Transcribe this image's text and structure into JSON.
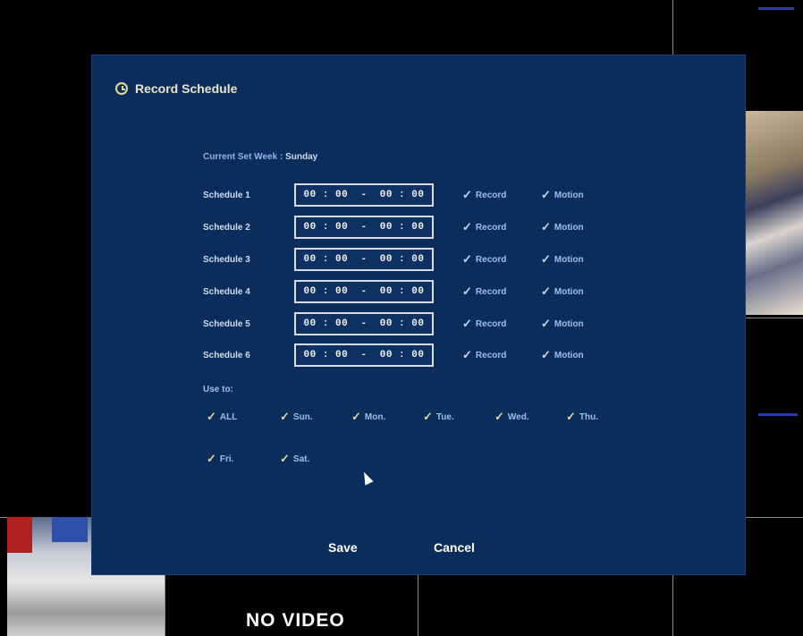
{
  "dialog": {
    "title": "Record Schedule",
    "current_week_label": "Current Set Week :",
    "current_week_value": "Sunday",
    "schedules": [
      {
        "label": "Schedule 1",
        "time": "00 : 00  -  00 : 00",
        "record": "Record",
        "motion": "Motion"
      },
      {
        "label": "Schedule 2",
        "time": "00 : 00  -  00 : 00",
        "record": "Record",
        "motion": "Motion"
      },
      {
        "label": "Schedule 3",
        "time": "00 : 00  -  00 : 00",
        "record": "Record",
        "motion": "Motion"
      },
      {
        "label": "Schedule 4",
        "time": "00 : 00  -  00 : 00",
        "record": "Record",
        "motion": "Motion"
      },
      {
        "label": "Schedule 5",
        "time": "00 : 00  -  00 : 00",
        "record": "Record",
        "motion": "Motion"
      },
      {
        "label": "Schedule 6",
        "time": "00 : 00  -  00 : 00",
        "record": "Record",
        "motion": "Motion"
      }
    ],
    "use_to_label": "Use to:",
    "days": [
      "ALL",
      "Sun.",
      "Mon.",
      "Tue.",
      "Wed.",
      "Thu.",
      "Fri.",
      "Sat."
    ],
    "save_label": "Save",
    "cancel_label": "Cancel"
  },
  "background": {
    "no_video_text": "NO VIDEO"
  },
  "icons": {
    "title_icon": "clock-icon",
    "checkmark": "checkmark-icon",
    "pointer": "mouse-cursor-icon"
  },
  "colors": {
    "dialog_bg": "#0b2d5c",
    "label_blue": "#9cc0ec",
    "grid": "#8a8a8a"
  }
}
